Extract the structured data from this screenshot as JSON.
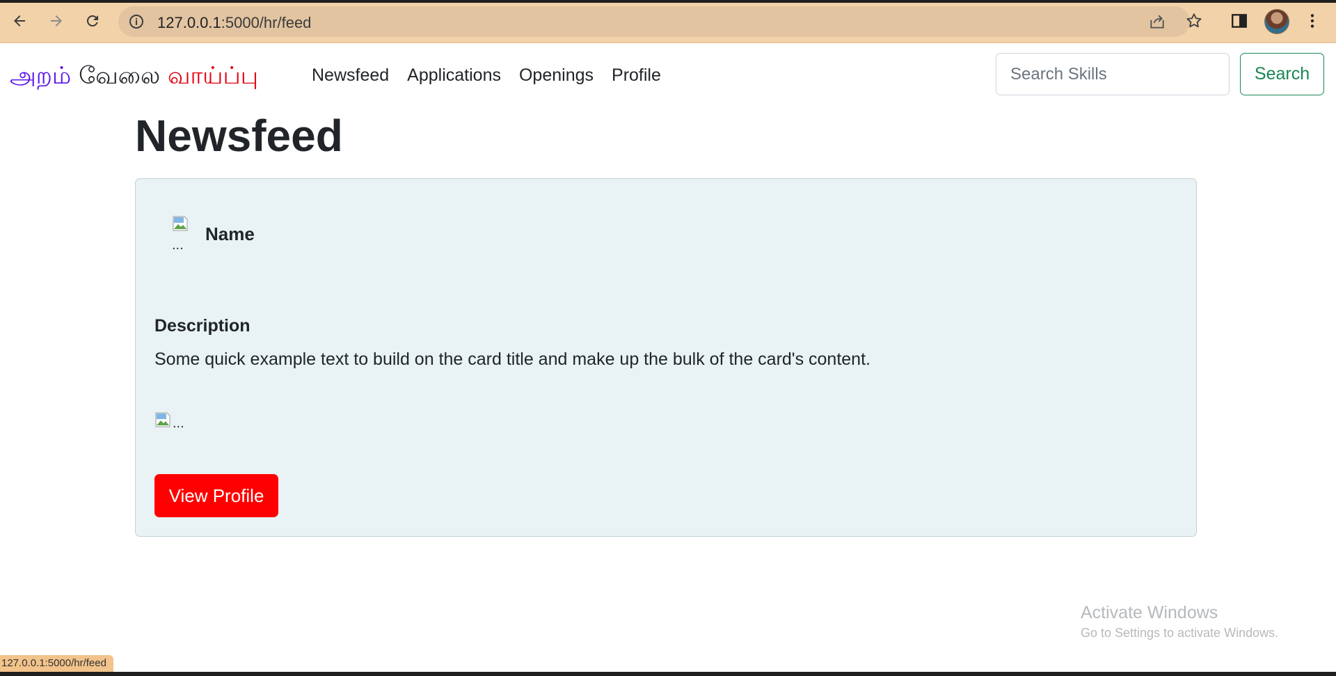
{
  "browser": {
    "url_host": "127.0.0.1",
    "url_rest": ":5000/hr/feed",
    "status_url": "127.0.0.1:5000/hr/feed"
  },
  "navbar": {
    "brand_part1": "அறம்",
    "brand_part2": "வேலை",
    "brand_part3": "வாய்ப்பு",
    "links": [
      "Newsfeed",
      "Applications",
      "Openings",
      "Profile"
    ],
    "search_placeholder": "Search Skills",
    "search_label": "Search"
  },
  "page": {
    "title": "Newsfeed"
  },
  "card": {
    "avatar_alt": "...",
    "name": "Name",
    "description_title": "Description",
    "text": "Some quick example text to build on the card title and make up the bulk of the card's content.",
    "image_alt": "...",
    "button_label": "View Profile"
  },
  "watermark": {
    "title": "Activate Windows",
    "subtitle": "Go to Settings to activate Windows."
  },
  "colors": {
    "brand_purple": "#5a16ee",
    "brand_red": "#e3000f",
    "search_green": "#198754",
    "view_button_red": "#ff0000",
    "card_bg": "#e9f2f4"
  }
}
